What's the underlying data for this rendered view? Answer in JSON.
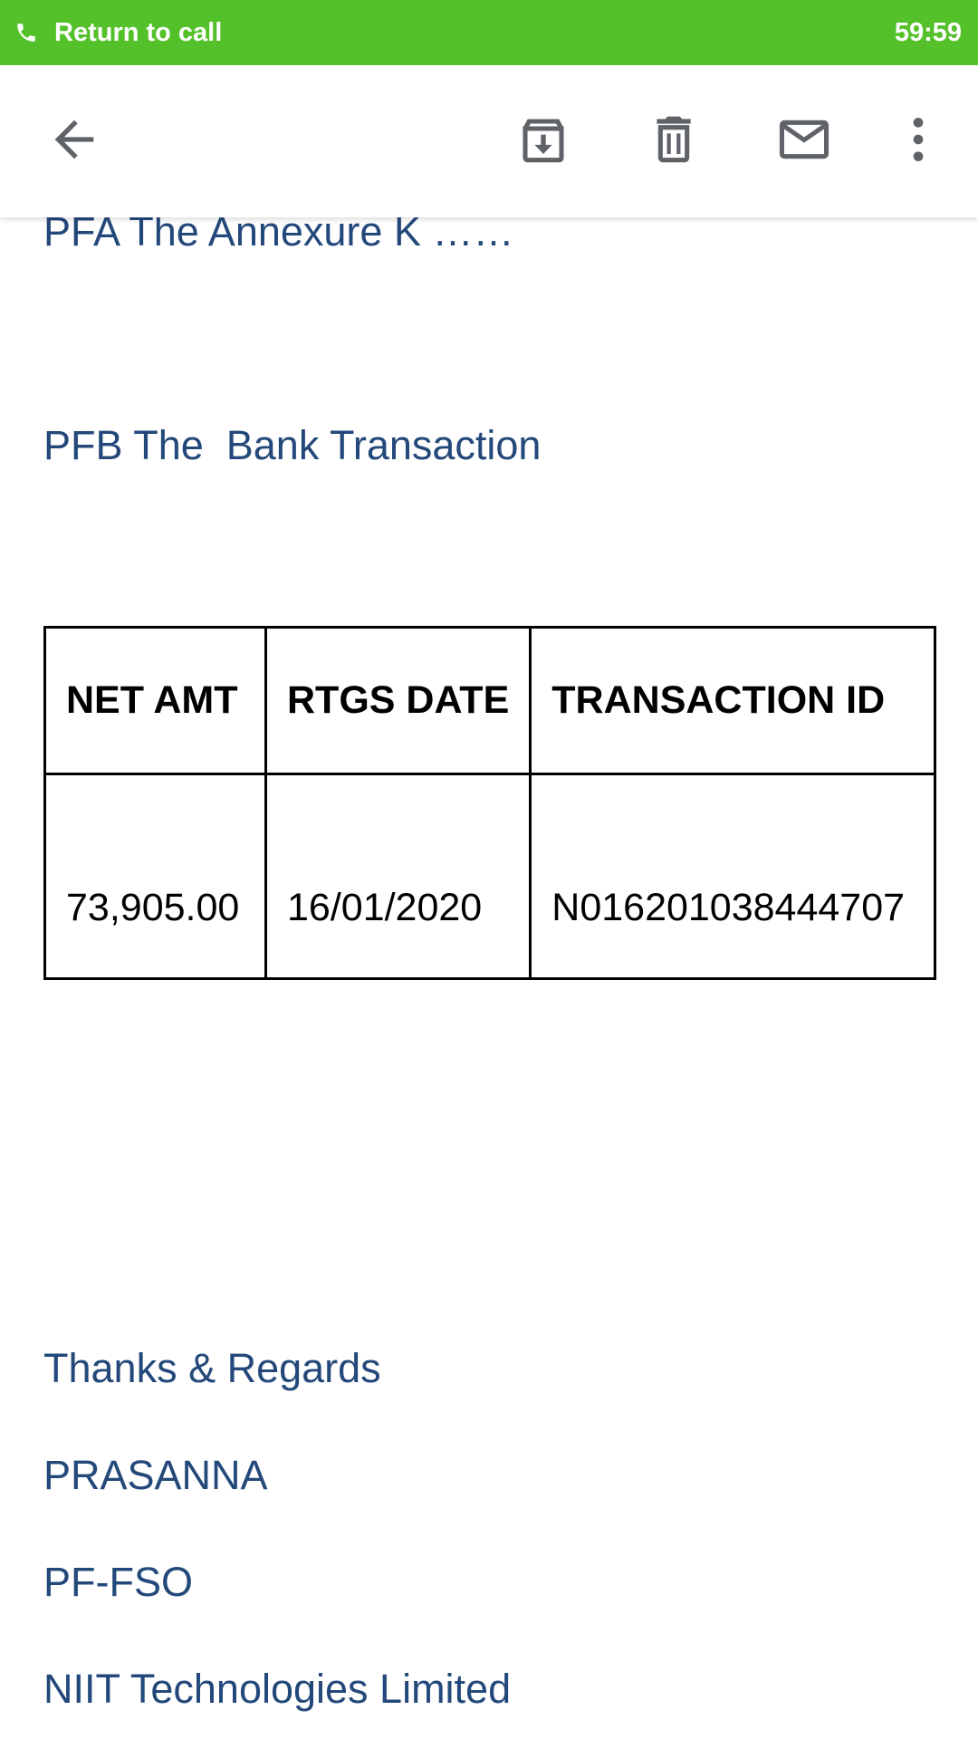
{
  "call_bar": {
    "label": "Return to call",
    "timer": "59:59",
    "color": "#55c12a"
  },
  "toolbar": {
    "back_icon": "arrow-back-icon",
    "archive_icon": "archive-icon",
    "delete_icon": "trash-icon",
    "mark_unread_icon": "mail-icon",
    "more_icon": "more-vert-icon"
  },
  "email": {
    "text_color": "#23487a",
    "line_annexure": "PFA The Annexure K ……",
    "line_bank": "PFB The  Bank Transaction",
    "table": {
      "headers": [
        "NET AMT",
        "RTGS DATE",
        "TRANSACTION ID"
      ],
      "rows": [
        [
          "73,905.00",
          "16/01/2020",
          "N016201038444707"
        ]
      ]
    },
    "signature": {
      "closing": "Thanks & Regards",
      "name": "PRASANNA",
      "dept": "PF-FSO",
      "company": "NIIT Technologies Limited"
    }
  }
}
